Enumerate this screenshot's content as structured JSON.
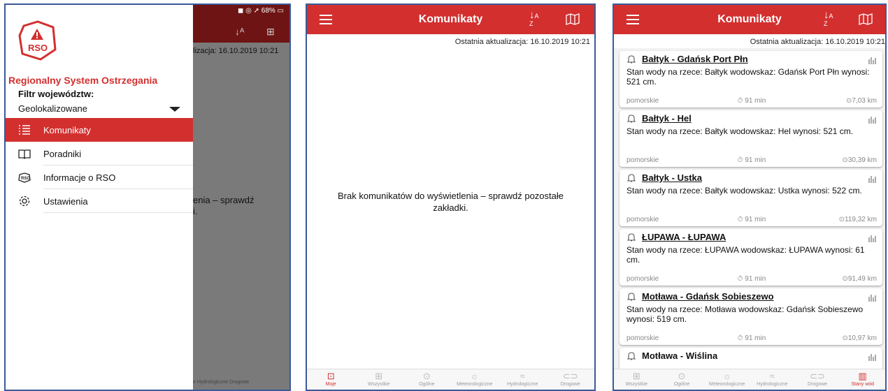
{
  "colors": {
    "brand_red": "#d32f2f",
    "dark_red": "#6e1414"
  },
  "screen1": {
    "status_text": "◼ ◎ ➚ 68% ▭",
    "update_partial": "lizacja: 16.10.2019 10:21",
    "msg_partial_line1": "enia – sprawdź",
    "msg_partial_line2": "i.",
    "nav_partial": "e Hydrologiczne  Drogowe",
    "logo_text": "RSO",
    "app_title": "Regionalny System Ostrzegania",
    "filter_label": "Filtr województw:",
    "filter_value": "Geolokalizowane",
    "menu": [
      {
        "label": "Komunikaty",
        "icon": "list-icon"
      },
      {
        "label": "Poradniki",
        "icon": "book-icon"
      },
      {
        "label": "Informacje o RSO",
        "icon": "rso-icon"
      },
      {
        "label": "Ustawienia",
        "icon": "gear-icon"
      }
    ]
  },
  "screen2": {
    "title": "Komunikaty",
    "last_update": "Ostatnia aktualizacja: 16.10.2019 10:21",
    "empty_message": "Brak komunikatów do wyświetlenia – sprawdź pozostałe zakładki.",
    "nav": [
      "Moje",
      "Wszystkie",
      "Ogólne",
      "Meteorologiczne",
      "Hydrologiczne",
      "Drogowe"
    ],
    "active_nav": "Moje"
  },
  "screen3": {
    "title": "Komunikaty",
    "last_update": "Ostatnia aktualizacja: 16.10.2019 10:21",
    "cards": [
      {
        "title": "Bałtyk - Gdańsk Port Płn",
        "body": "Stan wody na rzece: Bałtyk wodowskaz: Gdańsk Port Płn wynosi: 521 cm.",
        "region": "pomorskie",
        "time": "⏱ 91 min",
        "distance": "⊙7,03 km"
      },
      {
        "title": "Bałtyk - Hel",
        "body": "Stan wody na rzece: Bałtyk wodowskaz: Hel wynosi: 521 cm.",
        "region": "pomorskie",
        "time": "⏱ 91 min",
        "distance": "⊙30,39 km"
      },
      {
        "title": "Bałtyk - Ustka",
        "body": "Stan wody na rzece: Bałtyk wodowskaz: Ustka wynosi: 522 cm.",
        "region": "pomorskie",
        "time": "⏱ 91 min",
        "distance": "⊙119,32 km"
      },
      {
        "title": "ŁUPAWA - ŁUPAWA",
        "body": "Stan wody na rzece: ŁUPAWA wodowskaz: ŁUPAWA wynosi: 61 cm.",
        "region": "pomorskie",
        "time": "⏱ 91 min",
        "distance": "⊙91,49 km"
      },
      {
        "title": "Motława - Gdańsk Sobieszewo",
        "body": "Stan wody na rzece: Motława wodowskaz: Gdańsk Sobieszewo wynosi: 519 cm.",
        "region": "pomorskie",
        "time": "⏱ 91 min",
        "distance": "⊙10,97 km"
      },
      {
        "title": "Motława - Wiślina",
        "body": "",
        "region": "",
        "time": "",
        "distance": ""
      }
    ],
    "nav": [
      "Wszystkie",
      "Ogólne",
      "Meteorologiczne",
      "Hydrologiczne",
      "Drogowe",
      "Stany wód"
    ],
    "active_nav": "Stany wód"
  }
}
